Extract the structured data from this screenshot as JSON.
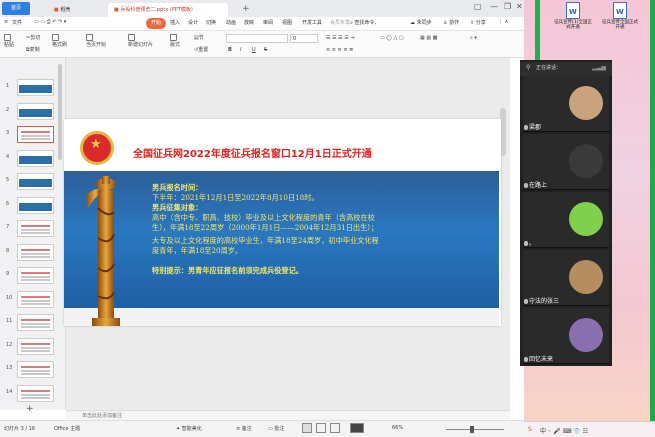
{
  "titlebar": {
    "home_tab": "首页",
    "tab2": "稻壳",
    "active_tab": "兵役科普预览二.pptx",
    "tab_status": "(PPT模板)"
  },
  "menu": {
    "file": "文件",
    "items": [
      "开始",
      "插入",
      "设计",
      "切换",
      "动画",
      "放映",
      "审阅",
      "视图",
      "开发工具",
      "会员专享"
    ],
    "search": "查找命令、",
    "right": [
      "未同步",
      "协作",
      "分享"
    ]
  },
  "toolbar": {
    "paste": "粘贴",
    "cut": "剪切",
    "copy": "复制",
    "format_painter": "格式刷",
    "slide_play": "当页开始",
    "new_slide": "新建幻灯片",
    "layout": "版式",
    "section": "节",
    "reset": "重置",
    "font_size_value": "0",
    "bold": "B",
    "italic": "I",
    "underline": "U",
    "strike": "S"
  },
  "thumbnails": [
    {
      "num": "1",
      "style": "blue"
    },
    {
      "num": "2",
      "style": "blue"
    },
    {
      "num": "3",
      "style": "white",
      "selected": true
    },
    {
      "num": "4",
      "style": "blue"
    },
    {
      "num": "5",
      "style": "blue"
    },
    {
      "num": "6",
      "style": "blue"
    },
    {
      "num": "7",
      "style": "white"
    },
    {
      "num": "8",
      "style": "white"
    },
    {
      "num": "9",
      "style": "white"
    },
    {
      "num": "10",
      "style": "white"
    },
    {
      "num": "11",
      "style": "white"
    },
    {
      "num": "12",
      "style": "white"
    },
    {
      "num": "13",
      "style": "white"
    },
    {
      "num": "14",
      "style": "white"
    }
  ],
  "slide": {
    "title": "全国征兵网2022年度征兵报名窗口12月1日正式开通",
    "lines": [
      {
        "text": "男兵报名时间：",
        "bold": true
      },
      {
        "text": "下半年：2021年12月1日至2022年8月10日18时。",
        "bold": false
      },
      {
        "text": "男兵征集对象：",
        "bold": true
      },
      {
        "text": "高中（含中专、职高、技校）毕业及以上文化程度的青年（含高校在校",
        "bold": false
      },
      {
        "text": "生），年满18至22周岁（2000年1月1日——2004年12月31日出生）；",
        "bold": false
      },
      {
        "text": "大专及以上文化程度的高校毕业生，年满18至24周岁，初中毕业文化程",
        "bold": false
      },
      {
        "text": "度青年，年满18至20周岁。",
        "bold": false
      },
      {
        "text": "特别提示：男青年应征报名前须完成兵役登记。",
        "bold": true
      }
    ]
  },
  "notes": {
    "placeholder": "单击此处添加备注"
  },
  "status": {
    "slide_pos": "幻灯片 3 / 16",
    "theme": "Office 主题",
    "smart_beautify": "智能美化",
    "notes_btn": "备注",
    "comment_btn": "批注",
    "zoom": "66%"
  },
  "video_panel": {
    "title": "正在讲话：",
    "participants": [
      {
        "name": "梁郡",
        "avatar_color": "#c9a27e"
      },
      {
        "name": "在路上",
        "avatar_color": "#3a3a3a"
      },
      {
        "name": "。",
        "avatar_color": "#7fd04a"
      },
      {
        "name": "守法的张三",
        "avatar_color": "#b58d5e"
      },
      {
        "name": "回忆未来",
        "avatar_color": "#8a6fb0"
      }
    ]
  },
  "desktop": {
    "file1": "征兵宣传(1)全国正式开通",
    "file2": "征兵宣传全国正式开通"
  },
  "colors": {
    "accent": "#2f7fe0",
    "title_red": "#e02020",
    "band_blue": "#2a78c0",
    "text_yellow": "#f2e76b",
    "ppt_orange": "#ec6a3c"
  }
}
